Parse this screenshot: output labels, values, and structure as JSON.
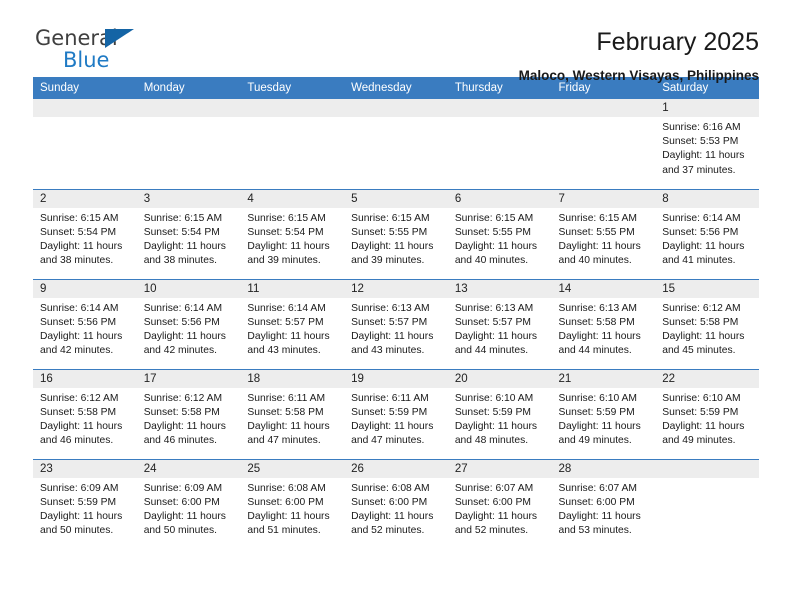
{
  "brand": {
    "name_part1": "General",
    "name_part2": "Blue",
    "triangle_color": "#1464a5",
    "blue": "#1f7ac4"
  },
  "header": {
    "title": "February 2025",
    "subtitle": "Maloco, Western Visayas, Philippines"
  },
  "theme": {
    "header_bg": "#3a7cc0",
    "daynum_bg": "#ededed",
    "row_border": "#3a7cc0"
  },
  "weekdays": [
    "Sunday",
    "Monday",
    "Tuesday",
    "Wednesday",
    "Thursday",
    "Friday",
    "Saturday"
  ],
  "weeks": [
    [
      {
        "day": "",
        "sunrise": "",
        "sunset": "",
        "daylight": "",
        "blank": true
      },
      {
        "day": "",
        "sunrise": "",
        "sunset": "",
        "daylight": "",
        "blank": true
      },
      {
        "day": "",
        "sunrise": "",
        "sunset": "",
        "daylight": "",
        "blank": true
      },
      {
        "day": "",
        "sunrise": "",
        "sunset": "",
        "daylight": "",
        "blank": true
      },
      {
        "day": "",
        "sunrise": "",
        "sunset": "",
        "daylight": "",
        "blank": true
      },
      {
        "day": "",
        "sunrise": "",
        "sunset": "",
        "daylight": "",
        "blank": true
      },
      {
        "day": "1",
        "sunrise": "Sunrise: 6:16 AM",
        "sunset": "Sunset: 5:53 PM",
        "daylight": "Daylight: 11 hours and 37 minutes."
      }
    ],
    [
      {
        "day": "2",
        "sunrise": "Sunrise: 6:15 AM",
        "sunset": "Sunset: 5:54 PM",
        "daylight": "Daylight: 11 hours and 38 minutes."
      },
      {
        "day": "3",
        "sunrise": "Sunrise: 6:15 AM",
        "sunset": "Sunset: 5:54 PM",
        "daylight": "Daylight: 11 hours and 38 minutes."
      },
      {
        "day": "4",
        "sunrise": "Sunrise: 6:15 AM",
        "sunset": "Sunset: 5:54 PM",
        "daylight": "Daylight: 11 hours and 39 minutes."
      },
      {
        "day": "5",
        "sunrise": "Sunrise: 6:15 AM",
        "sunset": "Sunset: 5:55 PM",
        "daylight": "Daylight: 11 hours and 39 minutes."
      },
      {
        "day": "6",
        "sunrise": "Sunrise: 6:15 AM",
        "sunset": "Sunset: 5:55 PM",
        "daylight": "Daylight: 11 hours and 40 minutes."
      },
      {
        "day": "7",
        "sunrise": "Sunrise: 6:15 AM",
        "sunset": "Sunset: 5:55 PM",
        "daylight": "Daylight: 11 hours and 40 minutes."
      },
      {
        "day": "8",
        "sunrise": "Sunrise: 6:14 AM",
        "sunset": "Sunset: 5:56 PM",
        "daylight": "Daylight: 11 hours and 41 minutes."
      }
    ],
    [
      {
        "day": "9",
        "sunrise": "Sunrise: 6:14 AM",
        "sunset": "Sunset: 5:56 PM",
        "daylight": "Daylight: 11 hours and 42 minutes."
      },
      {
        "day": "10",
        "sunrise": "Sunrise: 6:14 AM",
        "sunset": "Sunset: 5:56 PM",
        "daylight": "Daylight: 11 hours and 42 minutes."
      },
      {
        "day": "11",
        "sunrise": "Sunrise: 6:14 AM",
        "sunset": "Sunset: 5:57 PM",
        "daylight": "Daylight: 11 hours and 43 minutes."
      },
      {
        "day": "12",
        "sunrise": "Sunrise: 6:13 AM",
        "sunset": "Sunset: 5:57 PM",
        "daylight": "Daylight: 11 hours and 43 minutes."
      },
      {
        "day": "13",
        "sunrise": "Sunrise: 6:13 AM",
        "sunset": "Sunset: 5:57 PM",
        "daylight": "Daylight: 11 hours and 44 minutes."
      },
      {
        "day": "14",
        "sunrise": "Sunrise: 6:13 AM",
        "sunset": "Sunset: 5:58 PM",
        "daylight": "Daylight: 11 hours and 44 minutes."
      },
      {
        "day": "15",
        "sunrise": "Sunrise: 6:12 AM",
        "sunset": "Sunset: 5:58 PM",
        "daylight": "Daylight: 11 hours and 45 minutes."
      }
    ],
    [
      {
        "day": "16",
        "sunrise": "Sunrise: 6:12 AM",
        "sunset": "Sunset: 5:58 PM",
        "daylight": "Daylight: 11 hours and 46 minutes."
      },
      {
        "day": "17",
        "sunrise": "Sunrise: 6:12 AM",
        "sunset": "Sunset: 5:58 PM",
        "daylight": "Daylight: 11 hours and 46 minutes."
      },
      {
        "day": "18",
        "sunrise": "Sunrise: 6:11 AM",
        "sunset": "Sunset: 5:58 PM",
        "daylight": "Daylight: 11 hours and 47 minutes."
      },
      {
        "day": "19",
        "sunrise": "Sunrise: 6:11 AM",
        "sunset": "Sunset: 5:59 PM",
        "daylight": "Daylight: 11 hours and 47 minutes."
      },
      {
        "day": "20",
        "sunrise": "Sunrise: 6:10 AM",
        "sunset": "Sunset: 5:59 PM",
        "daylight": "Daylight: 11 hours and 48 minutes."
      },
      {
        "day": "21",
        "sunrise": "Sunrise: 6:10 AM",
        "sunset": "Sunset: 5:59 PM",
        "daylight": "Daylight: 11 hours and 49 minutes."
      },
      {
        "day": "22",
        "sunrise": "Sunrise: 6:10 AM",
        "sunset": "Sunset: 5:59 PM",
        "daylight": "Daylight: 11 hours and 49 minutes."
      }
    ],
    [
      {
        "day": "23",
        "sunrise": "Sunrise: 6:09 AM",
        "sunset": "Sunset: 5:59 PM",
        "daylight": "Daylight: 11 hours and 50 minutes."
      },
      {
        "day": "24",
        "sunrise": "Sunrise: 6:09 AM",
        "sunset": "Sunset: 6:00 PM",
        "daylight": "Daylight: 11 hours and 50 minutes."
      },
      {
        "day": "25",
        "sunrise": "Sunrise: 6:08 AM",
        "sunset": "Sunset: 6:00 PM",
        "daylight": "Daylight: 11 hours and 51 minutes."
      },
      {
        "day": "26",
        "sunrise": "Sunrise: 6:08 AM",
        "sunset": "Sunset: 6:00 PM",
        "daylight": "Daylight: 11 hours and 52 minutes."
      },
      {
        "day": "27",
        "sunrise": "Sunrise: 6:07 AM",
        "sunset": "Sunset: 6:00 PM",
        "daylight": "Daylight: 11 hours and 52 minutes."
      },
      {
        "day": "28",
        "sunrise": "Sunrise: 6:07 AM",
        "sunset": "Sunset: 6:00 PM",
        "daylight": "Daylight: 11 hours and 53 minutes."
      },
      {
        "day": "",
        "sunrise": "",
        "sunset": "",
        "daylight": "",
        "blank": true
      }
    ]
  ]
}
